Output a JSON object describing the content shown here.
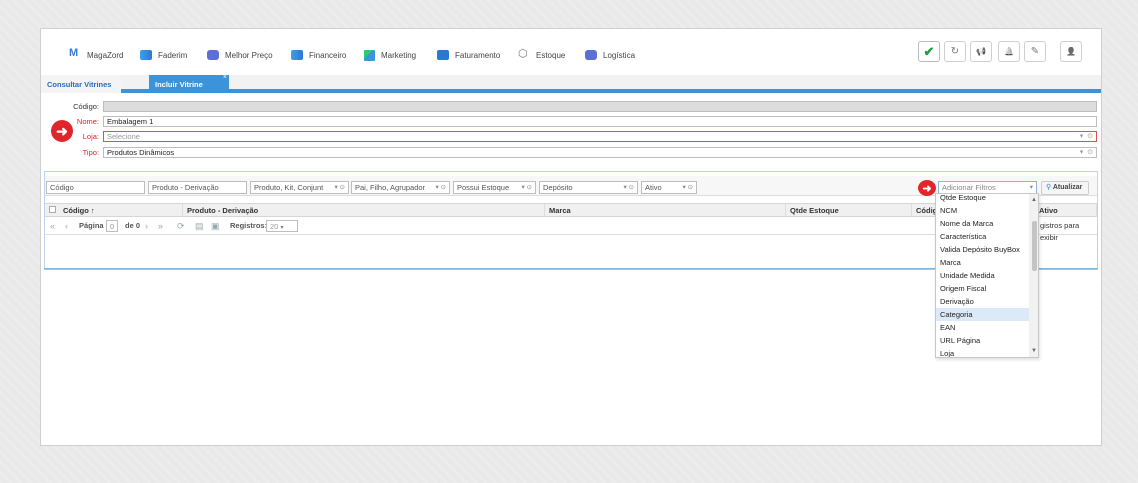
{
  "nav": {
    "items": [
      {
        "label": "MagaZord",
        "icon": "magazord-logo-icon"
      },
      {
        "label": "Faderim",
        "icon": "faderim-icon"
      },
      {
        "label": "Melhor Preço",
        "icon": "melhor-preco-icon"
      },
      {
        "label": "Financeiro",
        "icon": "financeiro-icon"
      },
      {
        "label": "Marketing",
        "icon": "marketing-icon"
      },
      {
        "label": "Faturamento",
        "icon": "faturamento-icon"
      },
      {
        "label": "Estoque",
        "icon": "estoque-icon"
      },
      {
        "label": "Logística",
        "icon": "logistica-icon"
      }
    ],
    "buttons": {
      "check": "✔",
      "refresh": "↻",
      "megaphone": "📢",
      "bell": "🔔",
      "edit": "✎",
      "user": "👤"
    }
  },
  "tabs": {
    "inactive": "Consultar Vitrines",
    "active": "Incluir Vitrine",
    "close": "×"
  },
  "form": {
    "codigo": {
      "label": "Código:",
      "value": ""
    },
    "nome": {
      "label": "Nome:",
      "value": "Embalagem 1"
    },
    "loja": {
      "label": "Loja:",
      "placeholder": "Selecione"
    },
    "tipo": {
      "label": "Tipo:",
      "value": "Produtos Dinâmicos"
    }
  },
  "filters": {
    "codigo": "Código",
    "produto": "Produto - Derivação",
    "tipo_produto": "Produto, Kit, Conjunt",
    "pai_filho": "Pai, Filho, Agrupador",
    "possui_estoque": "Possui Estoque",
    "deposito": "Depósito",
    "ativo": "Ativo",
    "adicionar": "Adicionar Filtros",
    "atualizar": "Atualizar"
  },
  "grid": {
    "columns": [
      "Código ↑",
      "Produto - Derivação",
      "Marca",
      "Qtde Estoque",
      "Códig",
      "Ativo"
    ],
    "pager": {
      "pagina_label": "Página",
      "pagina_value": "0",
      "de": "de 0",
      "registros_label": "Registros:",
      "registros_value": "20",
      "empty_msg": "gistros para exibir"
    }
  },
  "dropdown": {
    "items": [
      "Qtde Estoque",
      "NCM",
      "Nome da Marca",
      "Característica",
      "Valida Depósito BuyBox",
      "Marca",
      "Unidade Medida",
      "Origem Fiscal",
      "Derivação",
      "Categoria",
      "EAN",
      "URL Página",
      "Loja"
    ],
    "highlighted": "Categoria"
  },
  "colors": {
    "accent": "#3b93d9",
    "required": "#d22222",
    "arrow": "#e0262b",
    "highlight": "#dce9f7"
  }
}
